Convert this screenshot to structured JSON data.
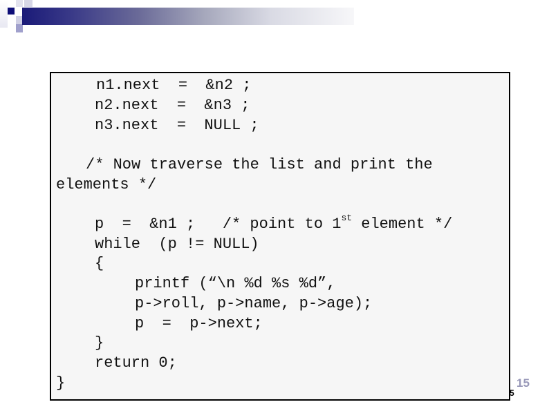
{
  "slide": {
    "code_lines": [
      "n1.next  =  &n2 ;",
      "n2.next  =  &n3 ;",
      "n3.next  =  NULL ;",
      "/* Now traverse the list and print the",
      "elements */",
      "p  =  &n1 ;   /* point to 1",
      "st",
      " element */",
      "while  (p != NULL)",
      "{",
      "printf (“\\n %d %s %d”,",
      "p->roll, p->name, p->age);",
      "p  =  p->next;",
      "}",
      "return 0;",
      "}"
    ],
    "page_number": "15",
    "page_sub": "5"
  },
  "colors": {
    "title_bar_start": "#1a1a78",
    "title_bar_end": "#f7f7f9",
    "box_fill": "#f6f6f6",
    "page_number": "#9898b8"
  }
}
